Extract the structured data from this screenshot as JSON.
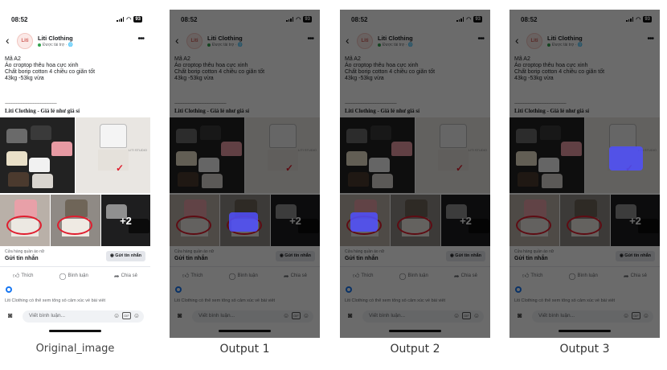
{
  "status_bar": {
    "time": "08:52",
    "battery": "93"
  },
  "header": {
    "page_name": "Liti Clothing",
    "sponsored": "Được tài trợ · 🌐",
    "avatar_text": "Liti",
    "back_icon": "chevron-left-icon",
    "more_icon": "more-dots-icon"
  },
  "post": {
    "lines": [
      "Mã A2",
      "Áo croptop thêu hoa cực xinh",
      "Chất borip cotton 4 chiều co giãn tốt",
      "43kg -53kg vừa"
    ],
    "separator": "-------------------------------------------",
    "shop_line": "Liti Clothing - Giá lẻ như giá sỉ",
    "more_photos": "+2"
  },
  "cta": {
    "subtitle": "Cửa hàng quần áo nữ",
    "title": "Gửi tin nhắn",
    "button": "Gửi tin nhắn"
  },
  "actions": {
    "like": "Thích",
    "comment": "Bình luận",
    "share": "Chia sẻ"
  },
  "info_text": "Liti Clothing có thể xem tổng số cảm xúc về bài viết",
  "composer": {
    "placeholder": "Viết bình luận...",
    "gif": "GIF"
  },
  "captions": [
    "Original_image",
    "Output 1",
    "Output 2",
    "Output 3"
  ],
  "colors": {
    "highlight_blue": "#5a5aff",
    "messenger_blue": "#1877f2"
  }
}
